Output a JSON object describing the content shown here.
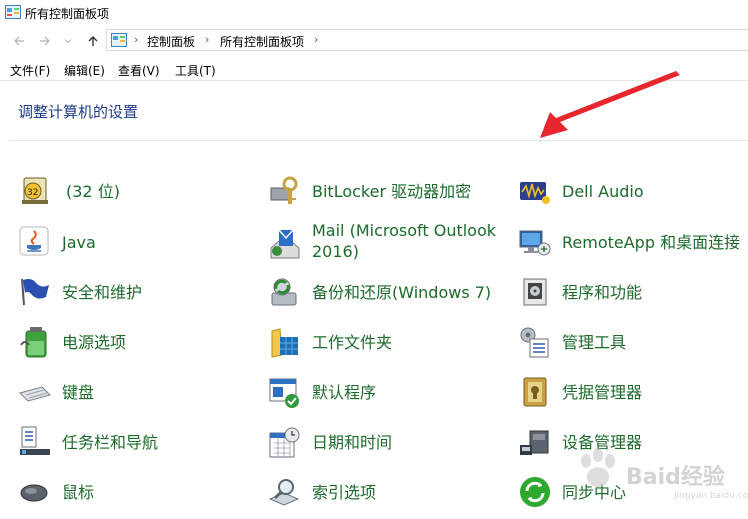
{
  "window": {
    "title": "所有控制面板项"
  },
  "nav": {
    "back_icon": "arrow-left-icon",
    "forward_icon": "arrow-right-icon",
    "recent_icon": "chevron-down-icon",
    "up_icon": "arrow-up-icon",
    "breadcrumb": [
      "控制面板",
      "所有控制面板项"
    ]
  },
  "menu": [
    "文件(F)",
    "编辑(E)",
    "查看(V)",
    "工具(T)"
  ],
  "heading": "调整计算机的设置",
  "items": [
    {
      "label": "(32 位)",
      "icon": "java-32bit-icon"
    },
    {
      "label": "BitLocker 驱动器加密",
      "icon": "bitlocker-icon"
    },
    {
      "label": "Dell Audio",
      "icon": "dell-audio-icon"
    },
    {
      "label": "Java",
      "icon": "java-icon"
    },
    {
      "label": "Mail (Microsoft Outlook",
      "label2": "2016)",
      "icon": "mail-icon"
    },
    {
      "label": "RemoteApp 和桌面连接",
      "icon": "remoteapp-icon"
    },
    {
      "label": "安全和维护",
      "icon": "security-flag-icon"
    },
    {
      "label": "备份和还原(Windows 7)",
      "icon": "backup-icon"
    },
    {
      "label": "程序和功能",
      "icon": "programs-icon"
    },
    {
      "label": "电源选项",
      "icon": "power-icon"
    },
    {
      "label": "工作文件夹",
      "icon": "work-folders-icon"
    },
    {
      "label": "管理工具",
      "icon": "admin-tools-icon"
    },
    {
      "label": "键盘",
      "icon": "keyboard-icon"
    },
    {
      "label": "默认程序",
      "icon": "default-programs-icon"
    },
    {
      "label": "凭据管理器",
      "icon": "credential-manager-icon"
    },
    {
      "label": "任务栏和导航",
      "icon": "taskbar-icon"
    },
    {
      "label": "日期和时间",
      "icon": "date-time-icon"
    },
    {
      "label": "设备管理器",
      "icon": "device-manager-icon"
    },
    {
      "label": "鼠标",
      "icon": "mouse-icon"
    },
    {
      "label": "索引选项",
      "icon": "indexing-icon"
    },
    {
      "label": "同步中心",
      "icon": "sync-center-icon"
    }
  ],
  "watermark": {
    "text": "Baid经验",
    "sub": "jingyan.baidu.com"
  },
  "colors": {
    "link_green": "#1c6b2c",
    "heading_blue": "#1e3d8c",
    "arrow_red": "#e8262e"
  }
}
